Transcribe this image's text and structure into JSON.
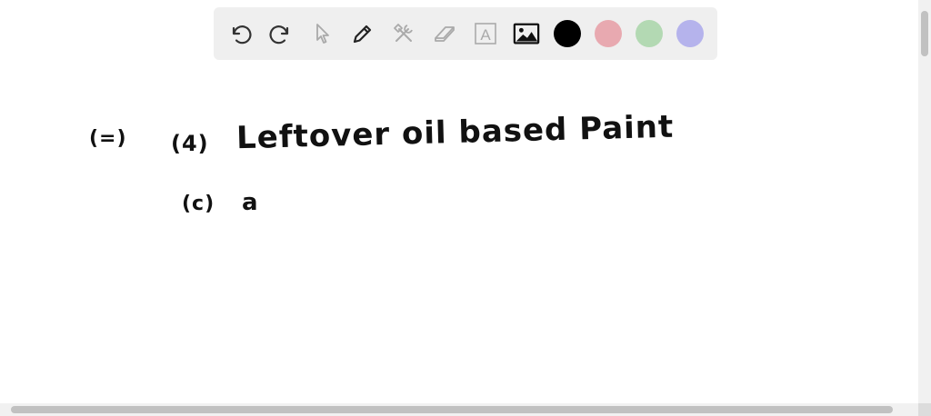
{
  "toolbar": {
    "tools": [
      {
        "name": "undo-icon"
      },
      {
        "name": "redo-icon"
      },
      {
        "name": "select-arrow-icon"
      },
      {
        "name": "pencil-icon"
      },
      {
        "name": "tools-icon"
      },
      {
        "name": "eraser-icon"
      },
      {
        "name": "text-icon",
        "glyph": "A"
      },
      {
        "name": "image-icon"
      }
    ],
    "colors": [
      "#000000",
      "#e8a9b0",
      "#b3d9b3",
      "#b5b3ec"
    ]
  },
  "handwriting": {
    "line1_prefix": "(=)",
    "line1_item": "(4)",
    "line1_text": "Leftover oil based Paint",
    "line2_item": "(c)",
    "line2_text": "a"
  }
}
